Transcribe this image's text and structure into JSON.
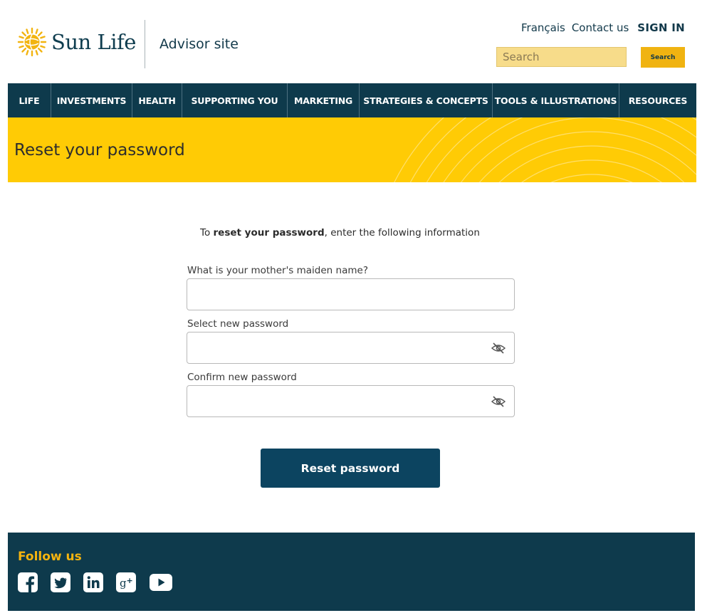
{
  "header": {
    "brand": "Sun Life",
    "site_name": "Advisor site",
    "links": {
      "language": "Français",
      "contact": "Contact us",
      "signin": "SIGN IN"
    },
    "search": {
      "placeholder": "Search",
      "button_label": "Search"
    }
  },
  "nav": {
    "items": [
      {
        "label": "LIFE"
      },
      {
        "label": "INVESTMENTS"
      },
      {
        "label": "HEALTH"
      },
      {
        "label": "SUPPORTING YOU"
      },
      {
        "label": "MARKETING"
      },
      {
        "label": "STRATEGIES & CONCEPTS"
      },
      {
        "label": "TOOLS & ILLUSTRATIONS"
      },
      {
        "label": "RESOURCES"
      }
    ]
  },
  "banner": {
    "title": "Reset your password"
  },
  "form": {
    "intro_prefix": "To ",
    "intro_bold": "reset your password",
    "intro_suffix": ", enter the following information",
    "maiden_label": "What is your mother's maiden name?",
    "maiden_value": "",
    "new_password_label": "Select new password",
    "new_password_value": "",
    "confirm_password_label": "Confirm new password",
    "confirm_password_value": "",
    "submit_label": "Reset password"
  },
  "footer": {
    "follow_label": "Follow us",
    "social_icons": [
      "facebook-icon",
      "twitter-icon",
      "linkedin-icon",
      "google-plus-icon",
      "youtube-icon"
    ]
  },
  "colors": {
    "navy": "#0e3a4c",
    "sun_yellow": "#ffcb05",
    "search_gold": "#f0b311",
    "button_blue": "#0c4460",
    "footer_accent": "#f5b40f"
  }
}
